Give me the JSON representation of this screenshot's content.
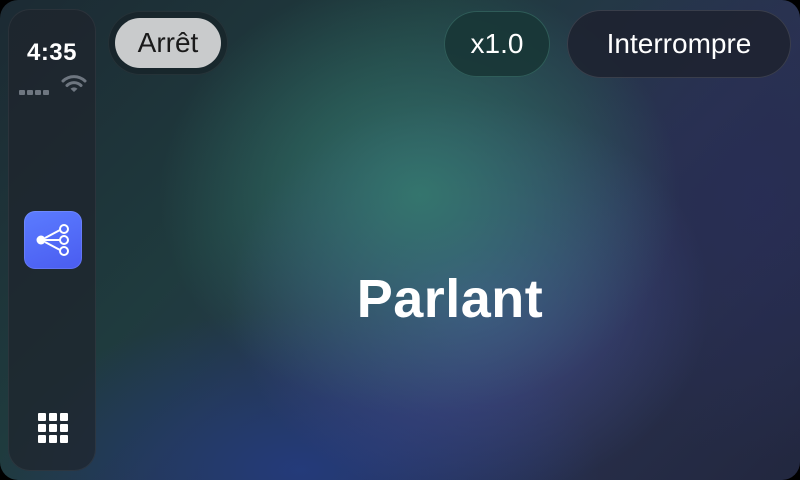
{
  "status_bar": {
    "time": "4:35"
  },
  "dock": {
    "app_icon": "share-network-icon",
    "app_grid_icon": "app-grid-icon"
  },
  "controls": {
    "stop_label": "Arrêt",
    "speed_label": "x1.0",
    "interrupt_label": "Interrompre"
  },
  "main": {
    "status_text": "Parlant"
  },
  "colors": {
    "app_icon_bg": "#4f6af6",
    "stop_button_bg": "#c9cbcc"
  }
}
